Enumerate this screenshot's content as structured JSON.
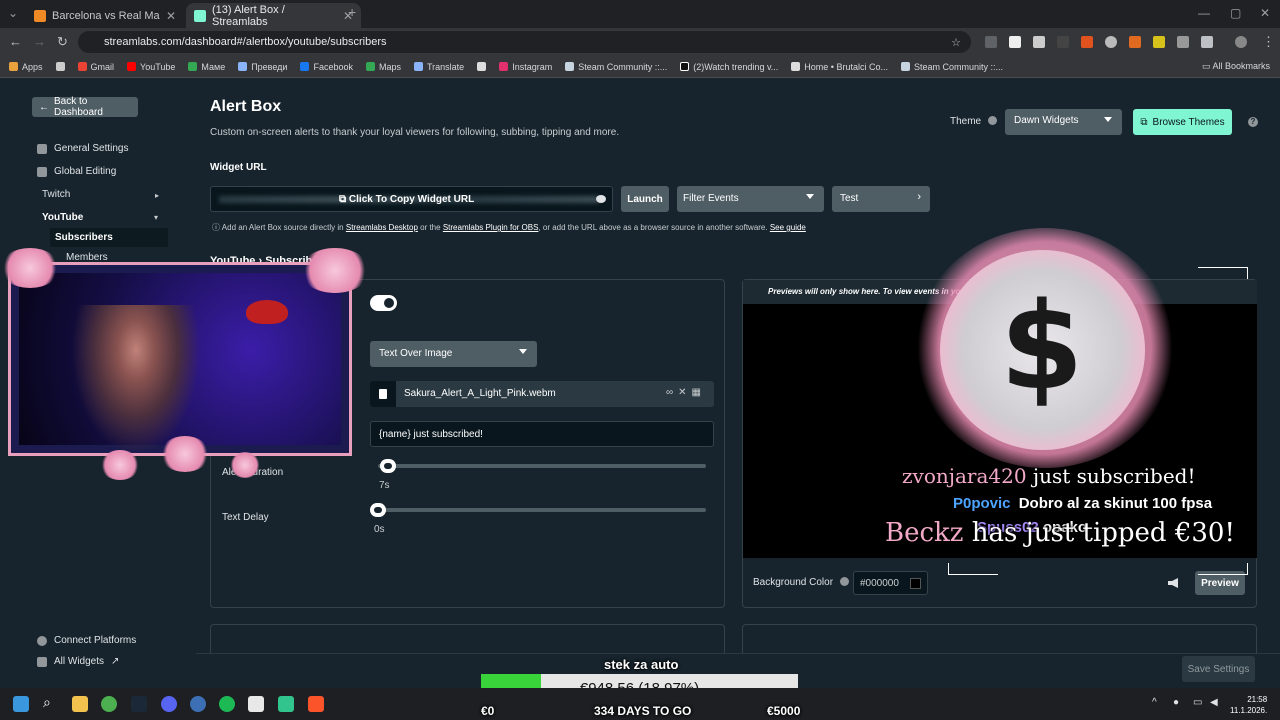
{
  "browser": {
    "tabs": [
      {
        "title": "Barcelona vs Real Madrid Live S",
        "active": false
      },
      {
        "title": "(13) Alert Box / Streamlabs",
        "active": true
      }
    ],
    "new_tab": "+",
    "url": "streamlabs.com/dashboard#/alertbox/youtube/subscribers",
    "bookmarks": [
      "Apps",
      "Gmail",
      "YouTube",
      "Маме",
      "Преведи",
      "Facebook",
      "Maps",
      "Translate",
      "Instagram",
      "Steam Community ::...",
      "(2)Watch trending v...",
      "Home • Brutalci Co...",
      "Steam Community ::..."
    ],
    "all_bookmarks": "All Bookmarks"
  },
  "sidebar": {
    "back": "Back to Dashboard",
    "general": "General Settings",
    "global": "Global Editing",
    "twitch": "Twitch",
    "youtube": "YouTube",
    "subscribers": "Subscribers",
    "members": "Members",
    "connect": "Connect Platforms",
    "all_widgets": "All Widgets"
  },
  "header": {
    "title": "Alert Box",
    "subtitle": "Custom on-screen alerts to thank your loyal viewers for following, subbing, tipping and more.",
    "theme_label": "Theme",
    "theme_value": "Dawn Widgets",
    "browse": "Browse Themes"
  },
  "widget": {
    "url_label": "Widget URL",
    "copy": "Click To Copy Widget URL",
    "launch": "Launch",
    "filter": "Filter Events",
    "test": "Test",
    "info_prefix": "Add an Alert Box source directly in",
    "info_link1": "Streamlabs Desktop",
    "info_mid": "or the",
    "info_link2": "Streamlabs Plugin for OBS",
    "info_suffix": ", or add the URL above as a browser source in another software.",
    "info_link3": "See guide"
  },
  "breadcrumb": "YouTube › Subscribers",
  "settings": {
    "layout": "Text Over Image",
    "file": "Sakura_Alert_A_Light_Pink.webm",
    "message": "{name} just subscribed!",
    "duration_label": "Alert Duration",
    "duration_value": "7s",
    "duration_level": 0.02,
    "delay_label": "Text Delay",
    "delay_value": "0s",
    "delay_level": 0.0
  },
  "preview": {
    "notice": "Previews will only show here. To view events in your stream, click the \"Test\" button above.",
    "bg_label": "Background Color",
    "bg_value": "#000000",
    "button": "Preview"
  },
  "overlay": {
    "sub_name": "zvonjara420",
    "sub_text": "just subscribed!",
    "chat1_user": "P0povic",
    "chat1_msg": "Dobro al za skinut 100 fpsa",
    "chat2_user": "Spuss02",
    "chat2_msg": "opako",
    "tip_name": "Beckz",
    "tip_text": "has just tipped €30!"
  },
  "goal": {
    "title": "stek za auto",
    "text": "€948.56 (18.97%)",
    "progress": 0.1897,
    "min": "€0",
    "max": "€5000",
    "days": "334 DAYS TO GO"
  },
  "save": "Save Settings",
  "taskbar": {
    "time": "21:58",
    "date": "11.1.2026."
  },
  "colors": {
    "accent": "#80f5d2",
    "background": "#17242d",
    "goal_fill": "#39d43a"
  }
}
